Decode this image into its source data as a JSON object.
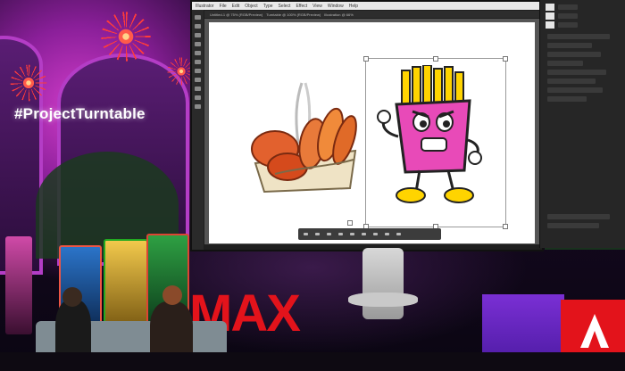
{
  "scene": {
    "hashtag": "#ProjectTurntable",
    "event_logo": "MAX",
    "colors": {
      "brand_red": "#e3131b",
      "stage_purple": "#b43dc6",
      "podium_purple": "#6a25c4"
    }
  },
  "screen": {
    "app_menubar": [
      "Illustrator",
      "File",
      "Edit",
      "Object",
      "Type",
      "Select",
      "Effect",
      "View",
      "Window",
      "Help"
    ],
    "tabs": [
      "Untitled-1 @ 75% (RGB/Preview)",
      "Turntable @ 100% (RGB/Preview)",
      "Illustration @ 66%"
    ],
    "artwork": [
      {
        "name": "bread-basket-illustration"
      },
      {
        "name": "fries-character-illustration"
      }
    ],
    "icons": [
      "selection-tool-icon",
      "zoom-icon",
      "hand-icon",
      "layers-icon"
    ]
  }
}
